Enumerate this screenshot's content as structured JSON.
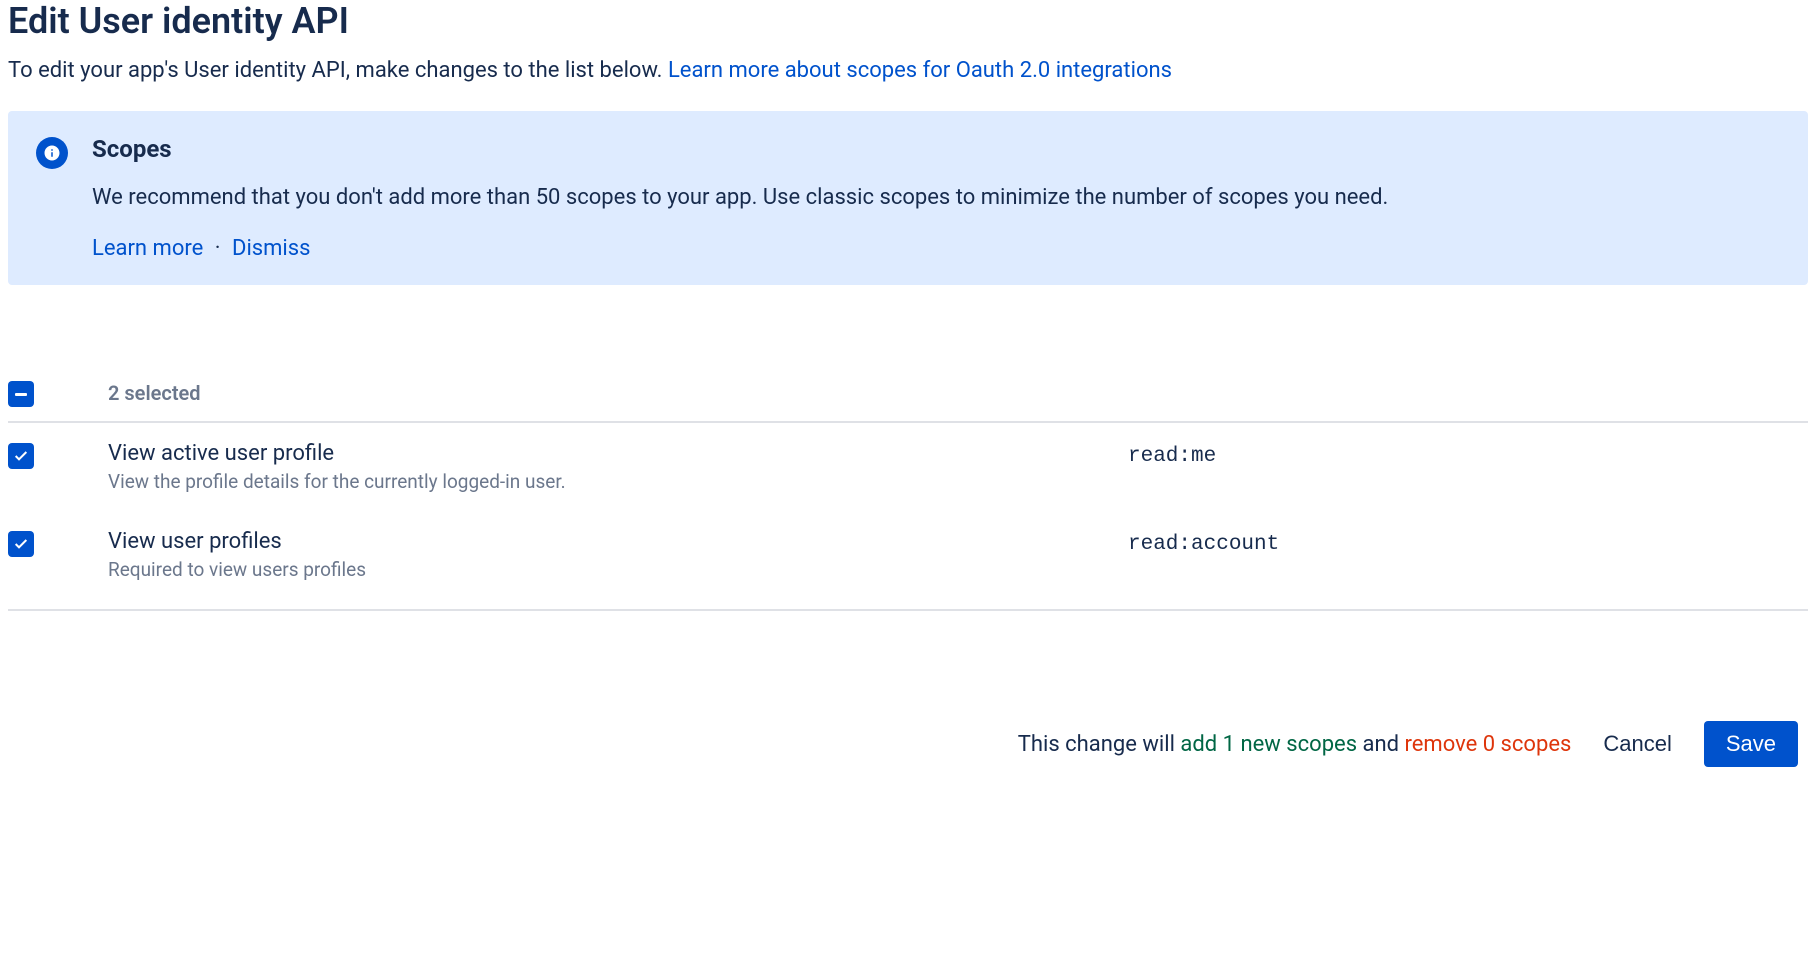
{
  "header": {
    "title": "Edit User identity API",
    "subtitle_prefix": "To edit your app's User identity API, make changes to the list below. ",
    "subtitle_link": "Learn more about scopes for Oauth 2.0 integrations"
  },
  "banner": {
    "title": "Scopes",
    "text": "We recommend that you don't add more than 50 scopes to your app. Use classic scopes to minimize the number of scopes you need.",
    "learn_more": "Learn more",
    "dismiss": "Dismiss"
  },
  "table": {
    "selected_label": "2 selected",
    "rows": [
      {
        "title": "View active user profile",
        "desc": "View the profile details for the currently logged-in user.",
        "code": "read:me"
      },
      {
        "title": "View user profiles",
        "desc": "Required to view users profiles",
        "code": "read:account"
      }
    ]
  },
  "footer": {
    "summary_prefix": "This change will ",
    "add_text": "add 1 new scopes",
    "summary_mid": " and ",
    "remove_text": "remove 0 scopes",
    "cancel": "Cancel",
    "save": "Save"
  }
}
